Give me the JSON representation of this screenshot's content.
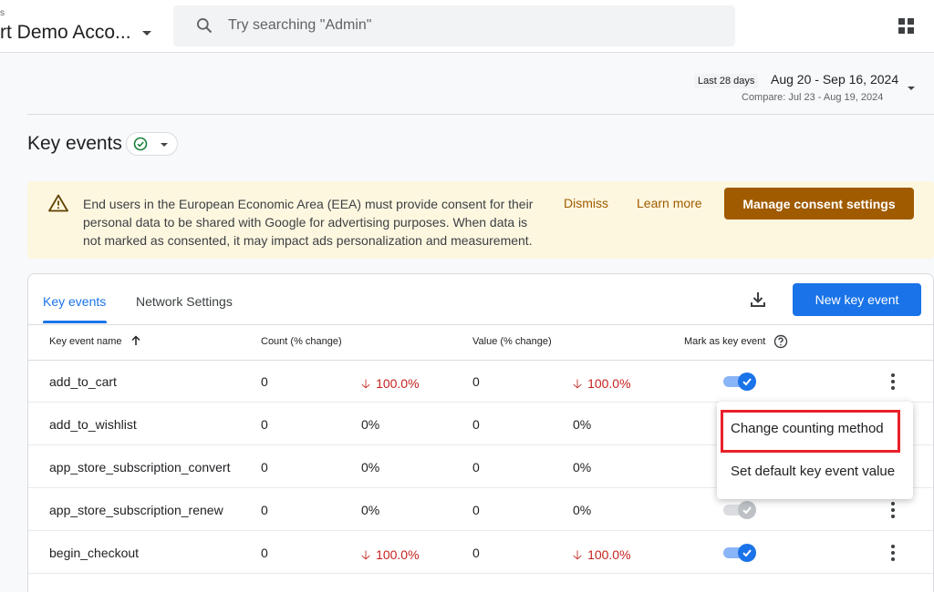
{
  "header": {
    "account_small": "s",
    "account_name": "rt Demo Acco...",
    "search_placeholder": "Try searching \"Admin\""
  },
  "date_range": {
    "chip": "Last 28 days",
    "range": "Aug 20 - Sep 16, 2024",
    "compare": "Compare: Jul 23 - Aug 19, 2024"
  },
  "page": {
    "title": "Key events"
  },
  "banner": {
    "text": "End users in the European Economic Area (EEA) must provide consent for their personal data to be shared with Google for advertising purposes. When data is not marked as consented, it may impact ads personalization and measurement.",
    "dismiss": "Dismiss",
    "learn_more": "Learn more",
    "manage": "Manage consent settings"
  },
  "tabs": [
    {
      "label": "Key events"
    },
    {
      "label": "Network Settings"
    }
  ],
  "toolbar": {
    "new_key_event": "New key event"
  },
  "table": {
    "headers": {
      "name": "Key event name",
      "count": "Count (% change)",
      "value": "Value (% change)",
      "mark": "Mark as key event"
    },
    "rows": [
      {
        "name": "add_to_cart",
        "count": "0",
        "count_change": "100.0%",
        "count_neg": true,
        "value": "0",
        "value_change": "100.0%",
        "value_neg": true,
        "marked": true
      },
      {
        "name": "add_to_wishlist",
        "count": "0",
        "count_change": "0%",
        "count_neg": false,
        "value": "0",
        "value_change": "0%",
        "value_neg": false,
        "marked": true
      },
      {
        "name": "app_store_subscription_convert",
        "count": "0",
        "count_change": "0%",
        "count_neg": false,
        "value": "0",
        "value_change": "0%",
        "value_neg": false,
        "marked": true
      },
      {
        "name": "app_store_subscription_renew",
        "count": "0",
        "count_change": "0%",
        "count_neg": false,
        "value": "0",
        "value_change": "0%",
        "value_neg": false,
        "marked": false
      },
      {
        "name": "begin_checkout",
        "count": "0",
        "count_change": "100.0%",
        "count_neg": true,
        "value": "0",
        "value_change": "100.0%",
        "value_neg": true,
        "marked": true
      }
    ]
  },
  "menu": {
    "change_counting": "Change counting method",
    "set_default_value": "Set default key event value"
  },
  "colors": {
    "primary": "#1a73e8",
    "warning_button": "#a05b00",
    "negative": "#c5221f",
    "highlight": "#e8202a"
  }
}
